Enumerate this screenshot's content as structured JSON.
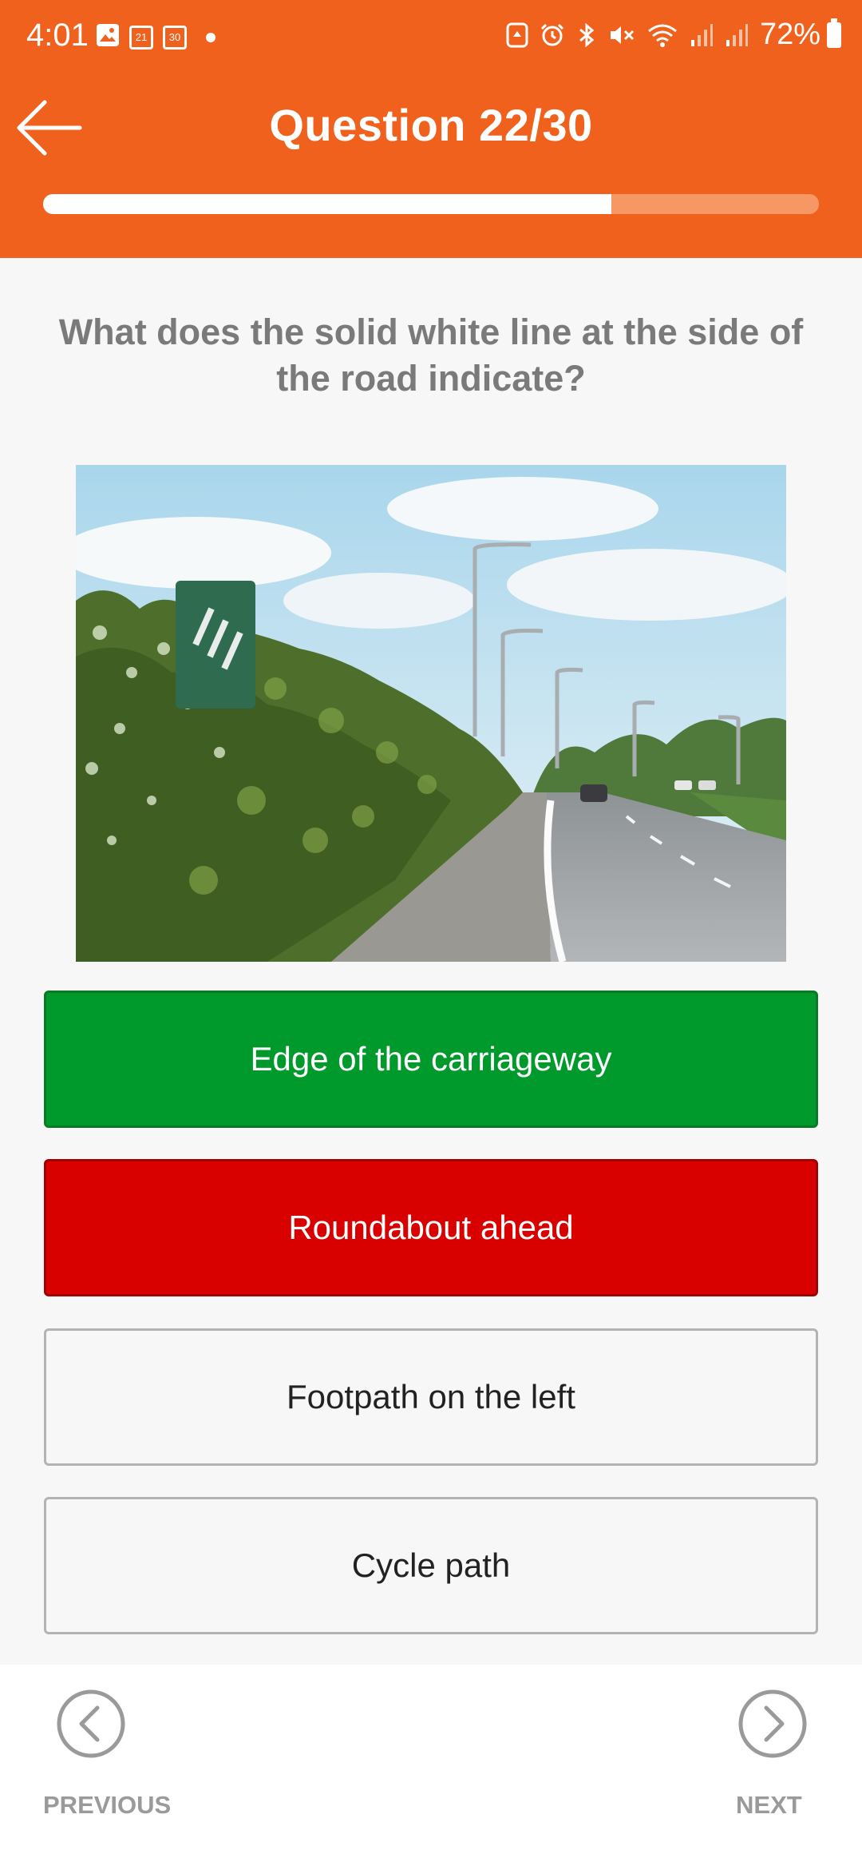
{
  "status_bar": {
    "time": "4:01",
    "calendar_day_1": "21",
    "calendar_day_2": "30",
    "battery": "72%"
  },
  "header": {
    "title": "Question 22/30",
    "progress_fraction": 0.733,
    "color": "#f0611d"
  },
  "question": {
    "text": "What does the solid white line at the side of the road indicate?"
  },
  "answers": [
    {
      "label": "Edge of the carriageway",
      "state": "correct"
    },
    {
      "label": "Roundabout ahead",
      "state": "wrong"
    },
    {
      "label": "Footpath on the left",
      "state": "unselected"
    },
    {
      "label": "Cycle path",
      "state": "unselected"
    }
  ],
  "footer": {
    "previous_label": "PREVIOUS",
    "next_label": "NEXT"
  }
}
